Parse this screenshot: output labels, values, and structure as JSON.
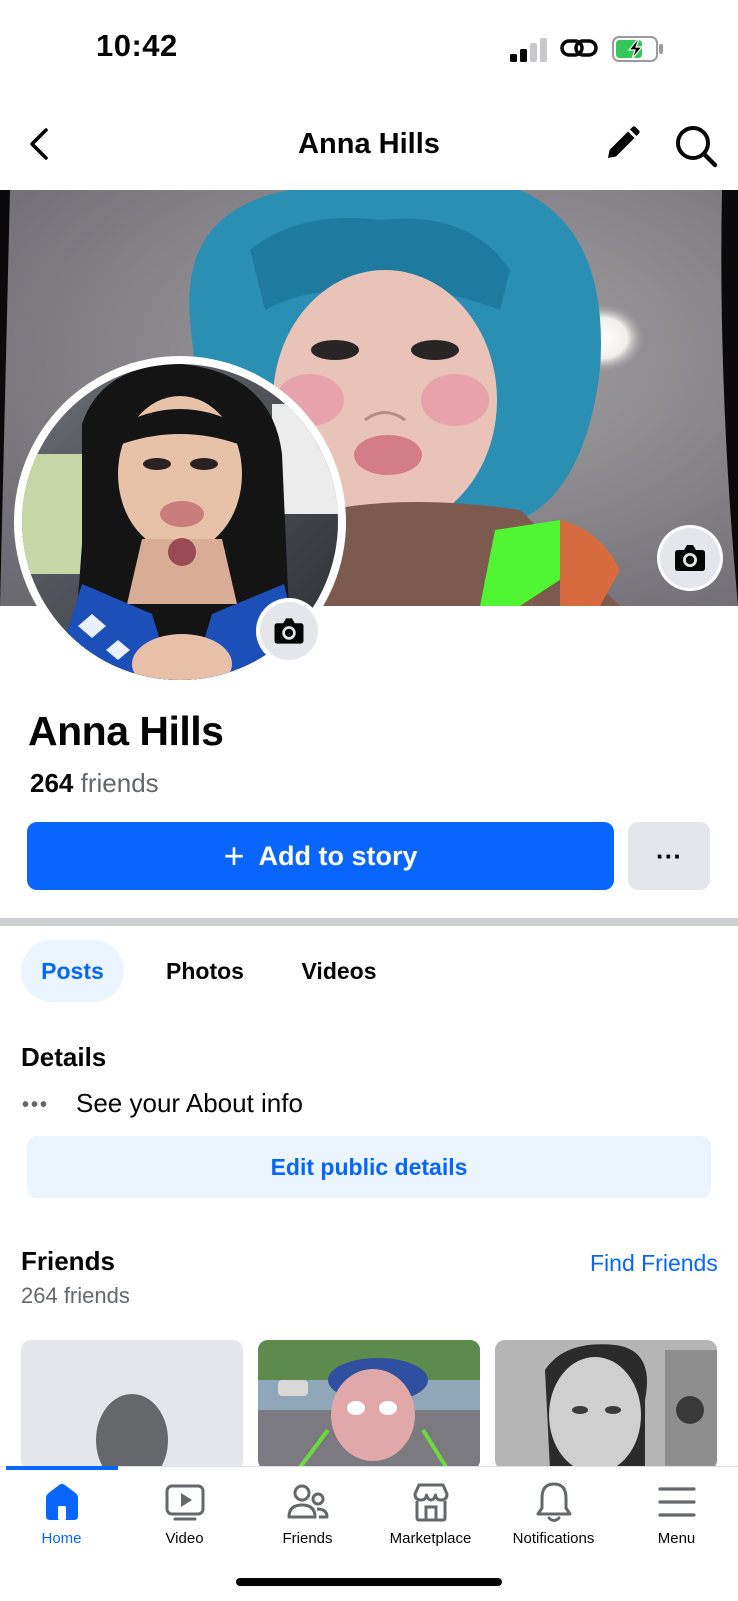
{
  "status_bar": {
    "time": "10:42",
    "icons": [
      "signal-icon",
      "link-icon",
      "battery-charging-icon"
    ]
  },
  "header": {
    "title": "Anna Hills",
    "icons": [
      "back-icon",
      "pencil-icon",
      "search-icon"
    ]
  },
  "profile": {
    "name": "Anna Hills",
    "friends_count": "264",
    "friends_label": "friends"
  },
  "actions": {
    "add_story": "Add to story",
    "more": "···"
  },
  "tabs": [
    {
      "label": "Posts",
      "active": true
    },
    {
      "label": "Photos",
      "active": false
    },
    {
      "label": "Videos",
      "active": false
    }
  ],
  "details": {
    "title": "Details",
    "about_dots": "•••",
    "about_text": "See your About info",
    "edit_button": "Edit public details"
  },
  "friends_section": {
    "title": "Friends",
    "count_text": "264 friends",
    "find_friends": "Find Friends"
  },
  "bottom_nav": [
    {
      "label": "Home",
      "icon": "home-icon",
      "active": true
    },
    {
      "label": "Video",
      "icon": "video-icon",
      "active": false
    },
    {
      "label": "Friends",
      "icon": "friends-icon",
      "active": false
    },
    {
      "label": "Marketplace",
      "icon": "marketplace-icon",
      "active": false
    },
    {
      "label": "Notifications",
      "icon": "bell-icon",
      "active": false
    },
    {
      "label": "Menu",
      "icon": "menu-icon",
      "active": false
    }
  ],
  "colors": {
    "accent": "#0866ff",
    "accent_light": "#ebf5ff",
    "secondary_bg": "#e4e6eb",
    "muted_text": "#65676b"
  }
}
